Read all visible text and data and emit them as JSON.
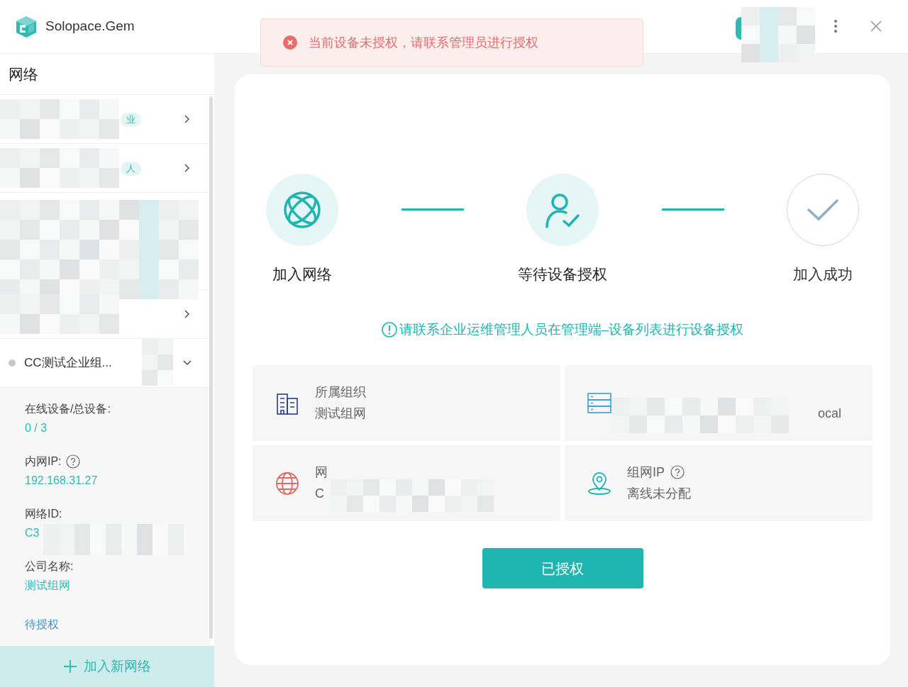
{
  "app": {
    "name": "Solopace.Gem"
  },
  "toast": {
    "kind": "error",
    "message": "当前设备未授权，请联系管理员进行授权"
  },
  "sidebar": {
    "title": "网络",
    "networks": [
      {
        "tag": "业",
        "expanded": false
      },
      {
        "tag": "人",
        "expanded": false
      },
      {
        "kind": "hidden"
      },
      {
        "expanded": false
      },
      {
        "name": "CC测试企业组...",
        "online": false,
        "expanded": true
      }
    ],
    "details": [
      {
        "label": "在线设备/总设备:",
        "value": "0 / 3"
      },
      {
        "label": "内网IP:",
        "help": true,
        "value": "192.168.31.27"
      },
      {
        "label": "网络ID:",
        "value": "C3",
        "redacted": true
      },
      {
        "label": "公司名称:",
        "value": "测试组网"
      }
    ],
    "status": "待授权",
    "add_button": "加入新网络"
  },
  "steps": [
    {
      "label": "加入网络",
      "reached": true,
      "kind": "globe"
    },
    {
      "label": "等待设备授权",
      "reached": true,
      "kind": "user"
    },
    {
      "label": "加入成功",
      "reached": false,
      "kind": "check"
    }
  ],
  "notice": "请联系企业运维管理人员在管理端–设备列表进行设备授权",
  "info_cards": [
    {
      "kind": "organization",
      "label": "所属组织",
      "value": "测试组网",
      "redacted": false
    },
    {
      "kind": "device",
      "value": "ocal",
      "redacted": true
    },
    {
      "kind": "network",
      "label": "网",
      "value": "C",
      "redacted": true
    },
    {
      "kind": "address",
      "label": "组网IP",
      "help": true,
      "value": "离线未分配",
      "redacted": false
    }
  ],
  "button": "已授权"
}
